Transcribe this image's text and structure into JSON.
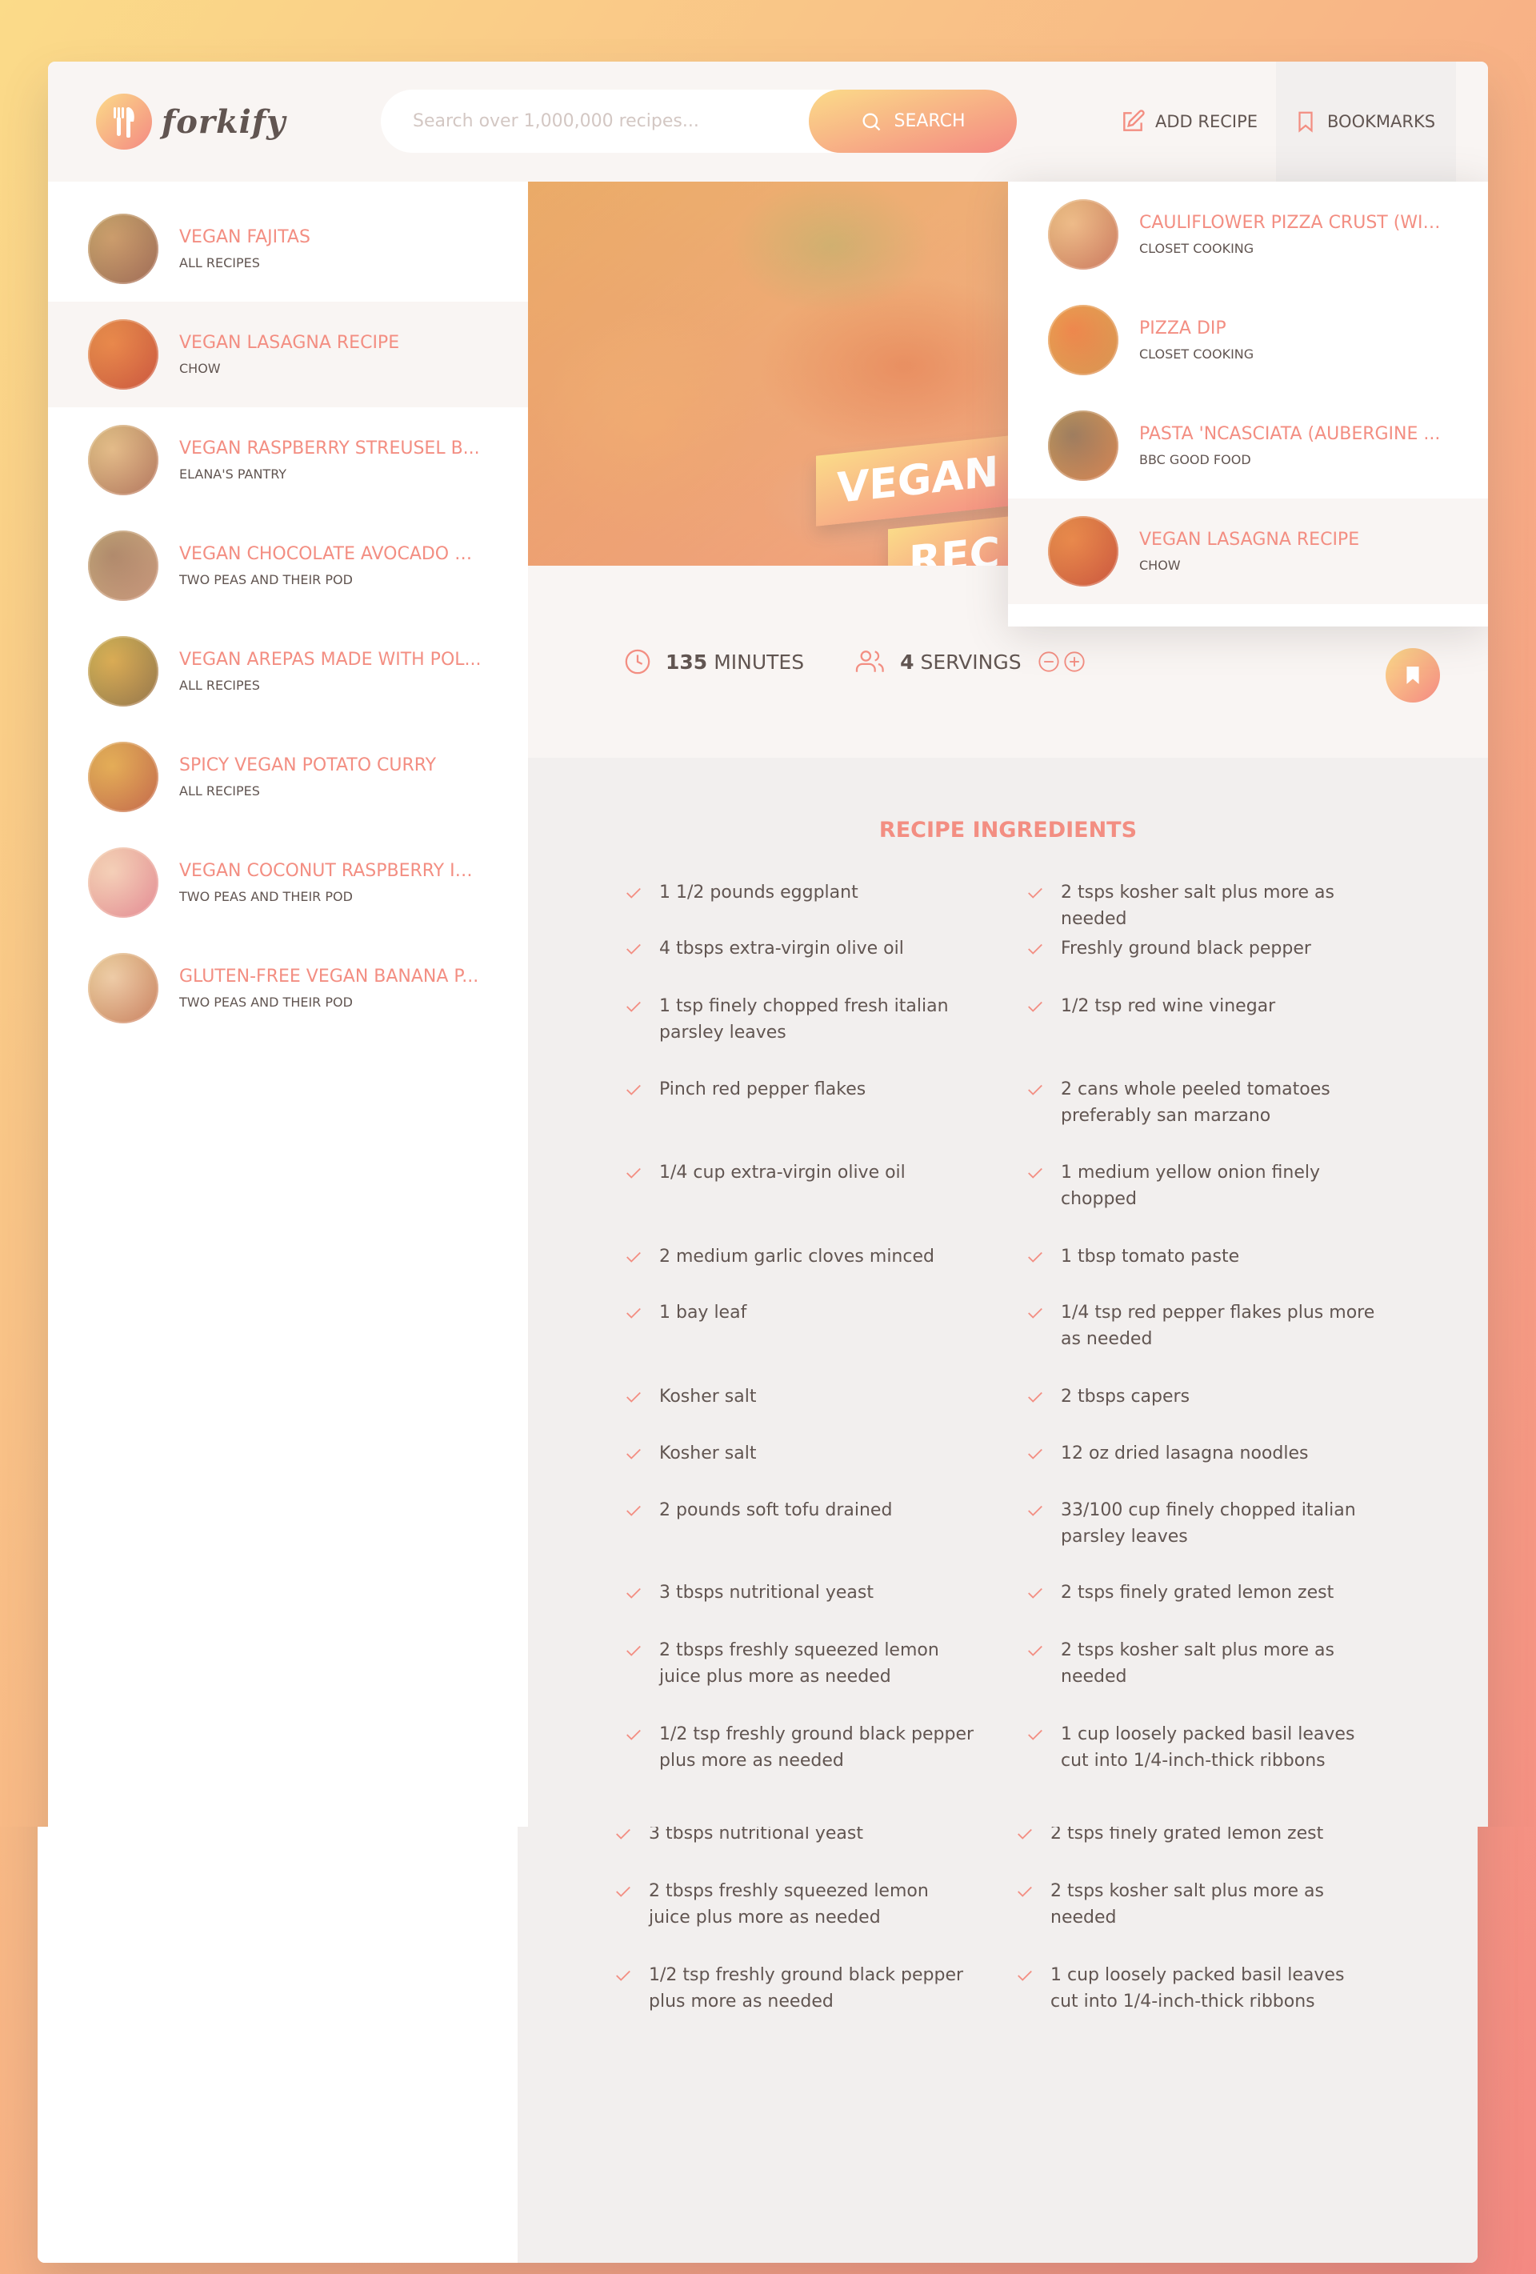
{
  "header": {
    "logo_text": "forkify",
    "search_placeholder": "Search over 1,000,000 recipes...",
    "search_button": "Search",
    "add_recipe": "Add recipe",
    "bookmarks": "Bookmarks"
  },
  "results": [
    {
      "title": "Vegan Fajitas",
      "publisher": "All Recipes",
      "colors": [
        "#b38a5e",
        "#6e5a3e"
      ]
    },
    {
      "title": "Vegan Lasagna Recipe",
      "publisher": "Chow",
      "colors": [
        "#e06b2c",
        "#b33a1a"
      ]
    },
    {
      "title": "Vegan Raspberry Streusel B...",
      "publisher": "Elana's Pantry",
      "colors": [
        "#d8b98a",
        "#8d6a4a"
      ]
    },
    {
      "title": "Vegan Chocolate Avocado C...",
      "publisher": "Two Peas and Their Pod",
      "colors": [
        "#8a6e5e",
        "#b3a27a"
      ]
    },
    {
      "title": "Vegan Arepas Made with Pol...",
      "publisher": "All Recipes",
      "colors": [
        "#c9a13a",
        "#5e6a2e"
      ]
    },
    {
      "title": "Spicy Vegan Potato Curry",
      "publisher": "All Recipes",
      "colors": [
        "#d9a33e",
        "#a8552e"
      ]
    },
    {
      "title": "Vegan Coconut Raspberry Ic...",
      "publisher": "Two Peas and Their Pod",
      "colors": [
        "#f2d8d2",
        "#d9889a"
      ]
    },
    {
      "title": "Gluten-Free Vegan Banana P...",
      "publisher": "Two Peas and Their Pod",
      "colors": [
        "#e8d2b8",
        "#b07a4a"
      ]
    }
  ],
  "bookmarks": [
    {
      "title": "Cauliflower Pizza Crust (wit...",
      "publisher": "Closet Cooking",
      "colors": [
        "#e8b98a",
        "#b36e4a"
      ]
    },
    {
      "title": "Pizza Dip",
      "publisher": "Closet Cooking",
      "colors": [
        "#e86a2e",
        "#c9a13a"
      ]
    },
    {
      "title": "Pasta 'Ncasciata (Aubergine ...",
      "publisher": "BBC Good Food",
      "colors": [
        "#6e5a4a",
        "#c9863a"
      ]
    },
    {
      "title": "Vegan Lasagna Recipe",
      "publisher": "Chow",
      "colors": [
        "#e06b2c",
        "#b33a1a"
      ]
    }
  ],
  "recipe": {
    "title_line1": "Vegan L",
    "title_line2": "Rec",
    "minutes": "135",
    "minutes_label": "minutes",
    "servings": "4",
    "servings_label": "servings",
    "ingredients_heading": "Recipe ingredients",
    "ingredients_left": [
      "1 1/2 pounds eggplant",
      "4 tbsps extra-virgin olive oil",
      "1 tsp finely chopped fresh italian parsley leaves",
      " Pinch red pepper flakes",
      "1/4 cup extra-virgin olive oil",
      "2 medium garlic cloves minced",
      "1 bay leaf",
      " Kosher salt",
      " Kosher salt",
      "2 pounds soft tofu drained",
      "3 tbsps nutritional yeast",
      "2 tbsps freshly squeezed lemon juice plus more as needed",
      "1/2 tsp freshly ground black pepper plus more as needed"
    ],
    "ingredients_right": [
      "2 tsps kosher salt plus more as needed",
      " Freshly ground black pepper",
      "1/2 tsp red wine vinegar",
      "2 cans whole peeled tomatoes preferably san marzano",
      "1 medium yellow onion finely chopped",
      "1 tbsp tomato paste",
      "1/4 tsp red pepper flakes plus more as needed",
      "2 tbsps capers",
      "12 oz dried lasagna noodles",
      "33/100 cup finely chopped italian parsley leaves",
      "2 tsps finely grated lemon zest",
      "2 tsps kosher salt plus more as needed",
      "1 cup loosely packed basil leaves cut into 1/4-inch-thick ribbons"
    ]
  },
  "colors": {
    "accent": "#f38e82",
    "grad_start": "#fbdb89",
    "grad_end": "#f48982",
    "text": "#615551"
  }
}
